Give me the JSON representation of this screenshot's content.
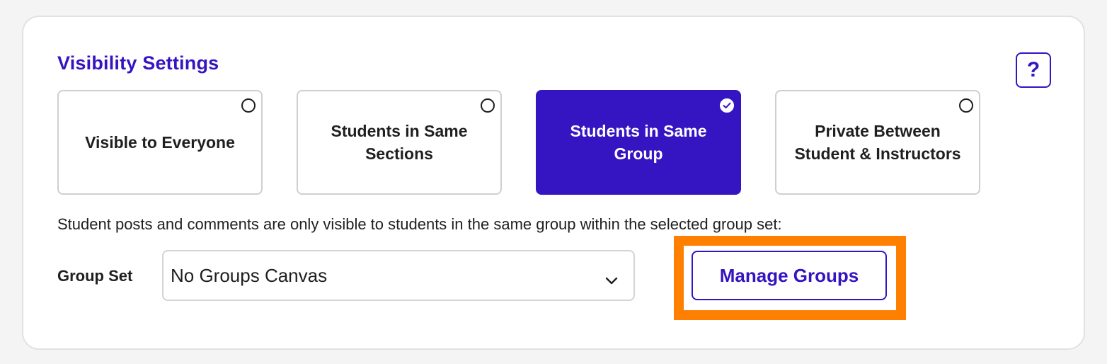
{
  "title": "Visibility Settings",
  "help": {
    "label": "?",
    "icon": "question-icon"
  },
  "options": [
    {
      "label": "Visible to Everyone",
      "selected": false
    },
    {
      "label": "Students in Same Sections",
      "selected": false
    },
    {
      "label": "Students in Same Group",
      "selected": true
    },
    {
      "label": "Private Between Student & Instructors",
      "selected": false
    }
  ],
  "description": "Student posts and comments are only visible to students in the same group within the selected group set:",
  "group_set": {
    "label": "Group Set",
    "selected_value": "No Groups Canvas"
  },
  "manage_groups_label": "Manage Groups",
  "colors": {
    "accent": "#3514c2",
    "highlight": "#ff8000"
  }
}
